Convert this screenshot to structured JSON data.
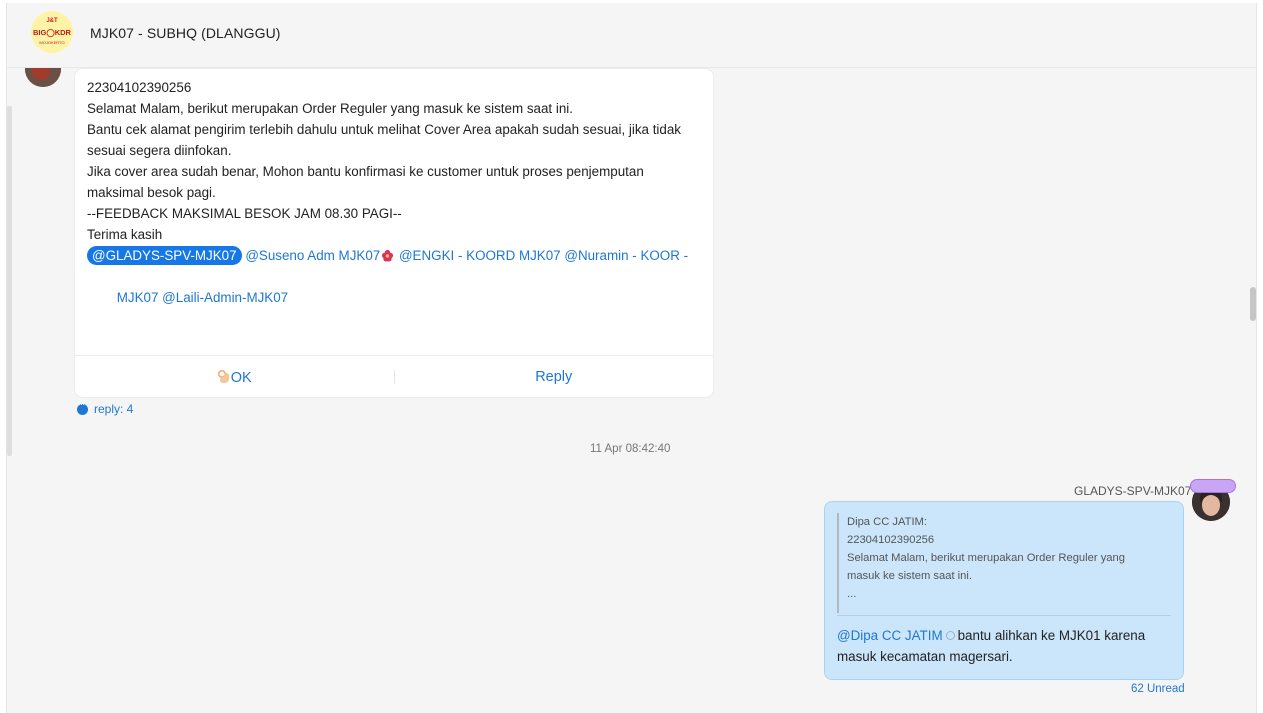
{
  "header": {
    "title": "MJK07 - SUBHQ (DLANGGU)",
    "logo_text": "BIG KDR"
  },
  "message": {
    "lines": [
      "22304102390256",
      "Selamat Malam, berikut merupakan Order Reguler yang masuk ke sistem saat ini.",
      "",
      "Bantu cek alamat pengirim terlebih dahulu untuk melihat Cover Area apakah sudah sesuai, jika tidak",
      "sesuai segera diinfokan.",
      "Jika cover area sudah benar, Mohon bantu konfirmasi ke customer untuk proses penjemputan",
      "maksimal besok pagi.",
      "",
      "--FEEDBACK MAKSIMAL BESOK JAM 08.30 PAGI--",
      "",
      "Terima kasih"
    ],
    "mention_me": "@GLADYS-SPV-MJK07",
    "mentions_line1": "@Suseno Adm MJK07",
    "mentions_line1b": "@ENGKI - KOORD MJK07 @Nuramin - KOOR -",
    "mentions_line2": "MJK07 @Laili-Admin-MJK07",
    "action_ok": "OK",
    "action_reply": "Reply",
    "reply_count": "reply: 4"
  },
  "timestamp": "11 Apr 08:42:40",
  "my_message": {
    "sender": "GLADYS-SPV-MJK07",
    "quote_lines": [
      "Dipa CC JATIM:",
      "22304102390256",
      "Selamat Malam, berikut merupakan Order Reguler yang",
      "masuk ke sistem saat ini.",
      "..."
    ],
    "mention": "@Dipa CC JATIM",
    "text_part1": "bantu alihkan ke MJK01 karena",
    "text_part2": "masuk kecamatan magersari.",
    "unread": "62 Unread"
  },
  "colors": {
    "accent": "#1e77d3",
    "mention_me_bg": "#1677e6",
    "my_bubble_bg": "#cbe6fb"
  }
}
